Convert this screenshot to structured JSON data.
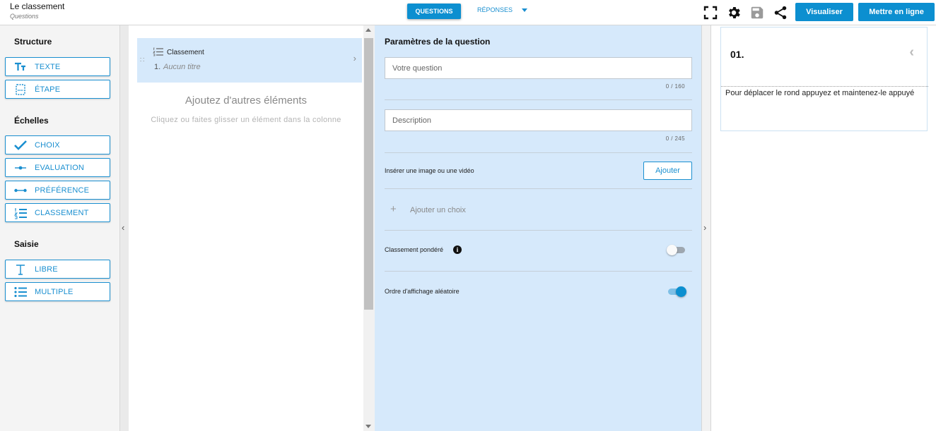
{
  "header": {
    "title": "Le classement",
    "subtitle": "Questions",
    "tabs": {
      "questions": "QUESTIONS",
      "reponses": "RÉPONSES"
    },
    "actions": {
      "preview": "Visualiser",
      "publish": "Mettre en ligne"
    },
    "icons": [
      "fullscreen-icon",
      "gear-icon",
      "save-icon",
      "share-icon"
    ]
  },
  "palette": {
    "sections": {
      "structure": "Structure",
      "echelles": "Échelles",
      "saisie": "Saisie"
    },
    "items": {
      "texte": "TEXTE",
      "etape": "ÉTAPE",
      "choix": "CHOIX",
      "evaluation": "EVALUATION",
      "preference": "PRÉFÉRENCE",
      "classement": "CLASSEMENT",
      "libre": "LIBRE",
      "multiple": "MULTIPLE"
    }
  },
  "column": {
    "card": {
      "type": "Classement",
      "number": "1.",
      "title": "Aucun titre"
    },
    "add_title": "Ajoutez d'autres éléments",
    "add_hint": "Cliquez ou faites glisser un élément dans la colonne"
  },
  "params": {
    "title": "Paramètres de la question",
    "question_placeholder": "Votre question",
    "question_count": "0 / 160",
    "description_placeholder": "Description",
    "description_count": "0 / 245",
    "media_label": "Insérer une image ou une vidéo",
    "media_button": "Ajouter",
    "add_choice": "Ajouter un choix",
    "weighted_label": "Classement pondéré",
    "weighted_on": false,
    "random_label": "Ordre d'affichage aléatoire",
    "random_on": true
  },
  "preview": {
    "number": "01.",
    "instruction": "Pour déplacer le rond appuyez et maintenez-le appuyé"
  },
  "colors": {
    "accent": "#0c8fd0",
    "panel": "#d6e9fb"
  }
}
